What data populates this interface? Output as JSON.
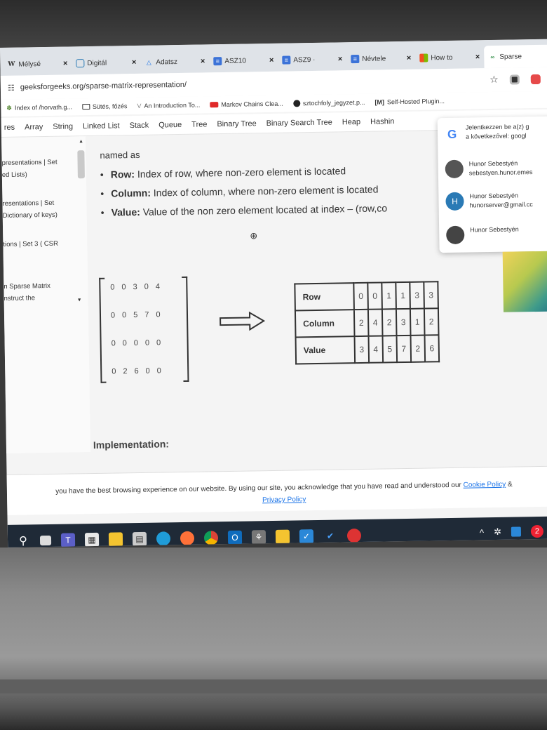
{
  "browser": {
    "tabs": [
      {
        "label": "Mélysé",
        "icon": "wikipedia-icon",
        "active": false
      },
      {
        "label": "Digitál",
        "icon": "page-icon",
        "active": false
      },
      {
        "label": "Adatsz",
        "icon": "drive-icon",
        "active": false
      },
      {
        "label": "ASZ10",
        "icon": "doc-icon",
        "active": false
      },
      {
        "label": "ASZ9 ·",
        "icon": "doc-icon",
        "active": false
      },
      {
        "label": "Névtele",
        "icon": "doc-icon",
        "active": false
      },
      {
        "label": "How to",
        "icon": "windows-icon",
        "active": false
      },
      {
        "label": "Sparse",
        "icon": "gfg-icon",
        "active": true
      }
    ],
    "url": "geeksforgeeks.org/sparse-matrix-representation/",
    "bookmarks": [
      {
        "label": "Index of /horvath.g...",
        "icon": "bookmark-leaf-icon"
      },
      {
        "label": "Sütés, főzés",
        "icon": "folder-icon"
      },
      {
        "label": "An Introduction To...",
        "icon": "bookmark-v-icon"
      },
      {
        "label": "Markov Chains Clea...",
        "icon": "youtube-icon"
      },
      {
        "label": "sztochfoly_jegyzet.p...",
        "icon": "github-icon"
      },
      {
        "label": "Self-Hosted Plugin...",
        "icon": "markdown-icon"
      }
    ]
  },
  "site_nav": [
    "res",
    "Array",
    "String",
    "Linked List",
    "Stack",
    "Queue",
    "Tree",
    "Binary Tree",
    "Binary Search Tree",
    "Heap",
    "Hashin"
  ],
  "sidebar": {
    "items": [
      {
        "line1": "presentations | Set",
        "line2": "ed Lists)"
      },
      {
        "line1": "resentations | Set",
        "line2": "Dictionary of keys)"
      },
      {
        "line1": "tions | Set 3 ( CSR",
        "line2": ""
      },
      {
        "line1": "n Sparse Matrix",
        "line2": "nstruct the"
      }
    ]
  },
  "article": {
    "named_as": "named as",
    "bullets": [
      {
        "term": "Row:",
        "text": " Index of row, where non-zero element is located"
      },
      {
        "term": "Column:",
        "text": " Index of column, where non-zero element is located"
      },
      {
        "term": "Value:",
        "text": " Value of the non zero element located at index – (row,co"
      }
    ],
    "matrix": [
      [
        "0",
        "0",
        "3",
        "0",
        "4"
      ],
      [
        "0",
        "0",
        "5",
        "7",
        "0"
      ],
      [
        "0",
        "0",
        "0",
        "0",
        "0"
      ],
      [
        "0",
        "2",
        "6",
        "0",
        "0"
      ]
    ],
    "triplet": {
      "row_label": "Row",
      "column_label": "Column",
      "value_label": "Value",
      "rows": [
        "0",
        "0",
        "1",
        "1",
        "3",
        "3"
      ],
      "columns": [
        "2",
        "4",
        "2",
        "3",
        "1",
        "2"
      ],
      "values": [
        "3",
        "4",
        "5",
        "7",
        "2",
        "6"
      ]
    },
    "implementation": "Implementation:"
  },
  "cookie": {
    "text": "you have the best browsing experience on our website. By using our site, you acknowledge that you have read and understood our",
    "cookie_policy": "Cookie Policy",
    "amp": "&",
    "privacy_policy": "Privacy Policy"
  },
  "account_popup": {
    "title_line1": "Jelentkezzen be a(z) g",
    "title_line2": "a következővel: googl",
    "accounts": [
      {
        "name": "Hunor Sebestyén",
        "email": "sebestyen.hunor.emes",
        "avatar_color": "#555555",
        "initial": ""
      },
      {
        "name": "Hunor Sebestyén",
        "email": "hunorserver@gmail.cc",
        "avatar_color": "#2a7ab5",
        "initial": "H"
      },
      {
        "name": "Hunor Sebestyén",
        "email": "",
        "avatar_color": "#444444",
        "initial": ""
      }
    ]
  },
  "taskbar": {
    "tray_badge": "2"
  },
  "colors": {
    "taskbar": "#1f2a37",
    "link": "#1a73e8",
    "gfg_green": "#2f8d46"
  }
}
